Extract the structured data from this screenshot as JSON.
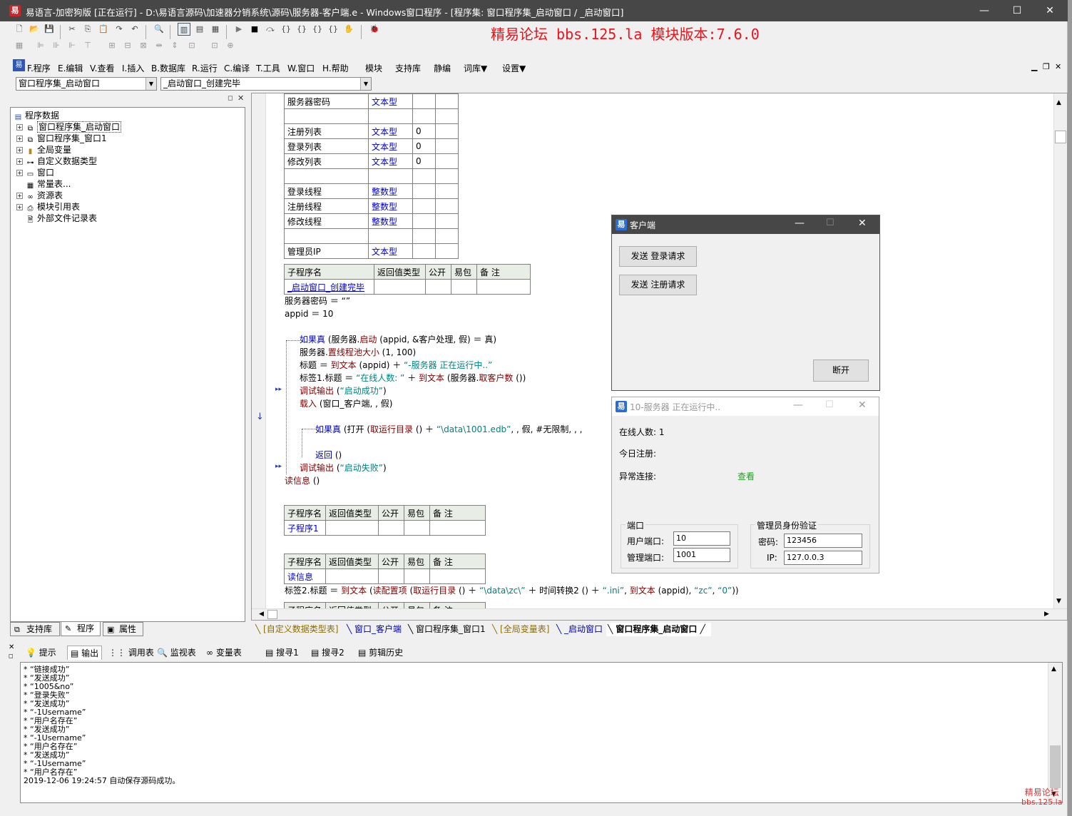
{
  "window": {
    "title": "易语言-加密狗版 [正在运行] - D:\\易语言源码\\加速器分销系统\\源码\\服务器-客户端.e - Windows窗口程序 - [程序集: 窗口程序集_启动窗口 / _启动窗口]",
    "min": "—",
    "max": "☐",
    "close": "✕"
  },
  "banner": "精易论坛 bbs.125.la 模块版本:7.6.0",
  "menu": [
    "F.程序",
    "E.编辑",
    "V.查看",
    "I.插入",
    "B.数据库",
    "R.运行",
    "C.编译",
    "T.工具",
    "W.窗口",
    "H.帮助",
    "模块",
    "支持库",
    "静编",
    "词库▼",
    "设置▼"
  ],
  "combos": {
    "left": "窗口程序集_启动窗口",
    "right": "_启动窗口_创建完毕"
  },
  "tree": {
    "root": "程序数据",
    "items": [
      "窗口程序集_启动窗口",
      "窗口程序集_窗口1",
      "全局变量",
      "自定义数据类型",
      "窗口",
      "常量表...",
      "资源表",
      "模块引用表",
      "外部文件记录表"
    ]
  },
  "left_tabs": [
    "支持库",
    "程序",
    "属性"
  ],
  "vars": {
    "rows": [
      [
        "服务器密码",
        "文本型",
        "",
        ""
      ],
      [
        "",
        "",
        "",
        ""
      ],
      [
        "注册列表",
        "文本型",
        "0",
        ""
      ],
      [
        "登录列表",
        "文本型",
        "0",
        ""
      ],
      [
        "修改列表",
        "文本型",
        "0",
        ""
      ],
      [
        "",
        "",
        "",
        ""
      ],
      [
        "登录线程",
        "整数型",
        "",
        ""
      ],
      [
        "注册线程",
        "整数型",
        "",
        ""
      ],
      [
        "修改线程",
        "整数型",
        "",
        ""
      ],
      [
        "",
        "",
        "",
        ""
      ],
      [
        "管理员IP",
        "文本型",
        "",
        ""
      ]
    ]
  },
  "sub_header": [
    "子程序名",
    "返回值类型",
    "公开",
    "易包",
    "备 注"
  ],
  "sub1": "_启动窗口_创建完毕",
  "sub2": "子程序1",
  "sub3": "读信息",
  "code": {
    "l1": "服务器密码 ＝ “”",
    "l2": "appid ＝ 10",
    "l3a": "如果真",
    "l3b": "(服务器.",
    "l3c": "启动",
    "l3d": "(appid, &客户处理, 假) ＝ 真)",
    "l4a": "服务器.",
    "l4b": "置线程池大小",
    "l4c": "(1, 100)",
    "l5a": "标题 ＝ ",
    "l5b": "到文本",
    "l5c": "(appid) ＋ ",
    "l5d": "“-服务器 正在运行中..”",
    "l6a": "标签1.标题 ＝ ",
    "l6b": "“在线人数: ”",
    "l6c": " ＋ ",
    "l6d": "到文本",
    "l6e": "(服务器.",
    "l6f": "取客户数",
    "l6g": "())",
    "l7a": "调试输出",
    "l7b": "(",
    "l7c": "“启动成功”",
    "l7d": ")",
    "l8a": "载入",
    "l8b": "(窗口_客户端, , 假)",
    "l9a": "如果真",
    "l9b": "(打开 (",
    "l9c": "取运行目录",
    "l9d": "() ＋ ",
    "l9e": "“\\data\\1001.edb”",
    "l9f": ", , 假, #无限制, , ,",
    "l10a": "返回",
    "l10b": "()",
    "l11a": "调试输出",
    "l11b": "(",
    "l11c": "“启动失败”",
    "l11d": ")",
    "l12a": "读信息",
    "l12b": "()",
    "l13a": "标签2.标题 ＝ ",
    "l13b": "到文本",
    "l13c": "(",
    "l13d": "读配置项",
    "l13e": "(",
    "l13f": "取运行目录",
    "l13g": "() ＋ ",
    "l13h": "“\\data\\zc\\”",
    "l13i": " ＋ 时间转换2 () ＋ ",
    "l13j": "“.ini”",
    "l13k": ", ",
    "l13l": "到文本",
    "l13m": "(appid), ",
    "l13n": "“zc”",
    "l13o": ", ",
    "l13p": "“0”",
    "l13q": "))"
  },
  "bottom_tabs": [
    "[自定义数据类型表]",
    "窗口_客户端",
    "窗口程序集_窗口1",
    "[全局变量表]",
    "_启动窗口",
    "窗口程序集_启动窗口"
  ],
  "out_tabs": [
    "提示",
    "输出",
    "调用表",
    "监视表",
    "变量表",
    "搜寻1",
    "搜寻2",
    "剪辑历史"
  ],
  "output": [
    "* “链接成功”",
    "* “发送成功”",
    "* “1005&no”",
    "* “登录失败”",
    "* “发送成功”",
    "* “-1Username”",
    "* “用户名存在”",
    "* “发送成功”",
    "* “-1Username”",
    "* “用户名存在”",
    "* “发送成功”",
    "* “-1Username”",
    "* “用户名存在”",
    "2019-12-06 19:24:57 自动保存源码成功。"
  ],
  "client": {
    "title": "客户端",
    "btn_login": "发送 登录请求",
    "btn_reg": "发送 注册请求",
    "btn_disconnect": "断开"
  },
  "server": {
    "title": "10-服务器 正在运行中..",
    "online_label": "在线人数: 1",
    "today_label": "今日注册:",
    "abnormal_label": "异常连接:",
    "view_link": "查看",
    "port_group": "端口",
    "user_port_label": "用户端口:",
    "user_port": "10",
    "admin_port_label": "管理端口:",
    "admin_port": "1001",
    "admin_group": "管理员身份验证",
    "pwd_label": "密码:",
    "pwd": "123456",
    "ip_label": "IP:",
    "ip": "127.0.0.3"
  },
  "watermark": {
    "line1": "精易论坛",
    "line2": "bbs.125.la"
  },
  "colors": {
    "titlebar": "#474747",
    "banner": "#e8141b",
    "keyword_blue": "#0000aa",
    "string_teal": "#008080"
  }
}
